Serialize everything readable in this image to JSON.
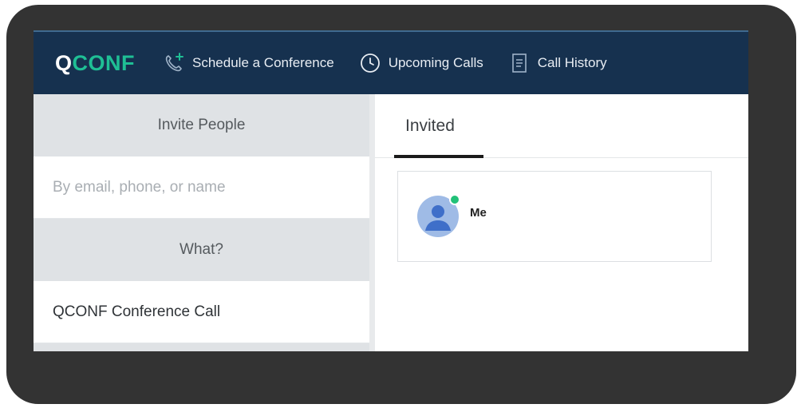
{
  "app": {
    "logo_q": "Q",
    "logo_rest": "CONF"
  },
  "nav": {
    "items": [
      {
        "label": "Schedule a Conference",
        "icon": "phone-plus-icon"
      },
      {
        "label": "Upcoming Calls",
        "icon": "clock-icon"
      },
      {
        "label": "Call History",
        "icon": "document-icon"
      }
    ]
  },
  "left": {
    "invite_heading": "Invite People",
    "invite_placeholder": "By email, phone, or name",
    "what_heading": "What?",
    "what_value": "QCONF Conference Call"
  },
  "right": {
    "tab_invited": "Invited",
    "participants": [
      {
        "name": "Me",
        "status": "online",
        "status_color": "#22c178"
      }
    ]
  },
  "colors": {
    "nav_bg": "#16314f",
    "brand_accent": "#1fbf95",
    "frame_bg": "#333333"
  }
}
